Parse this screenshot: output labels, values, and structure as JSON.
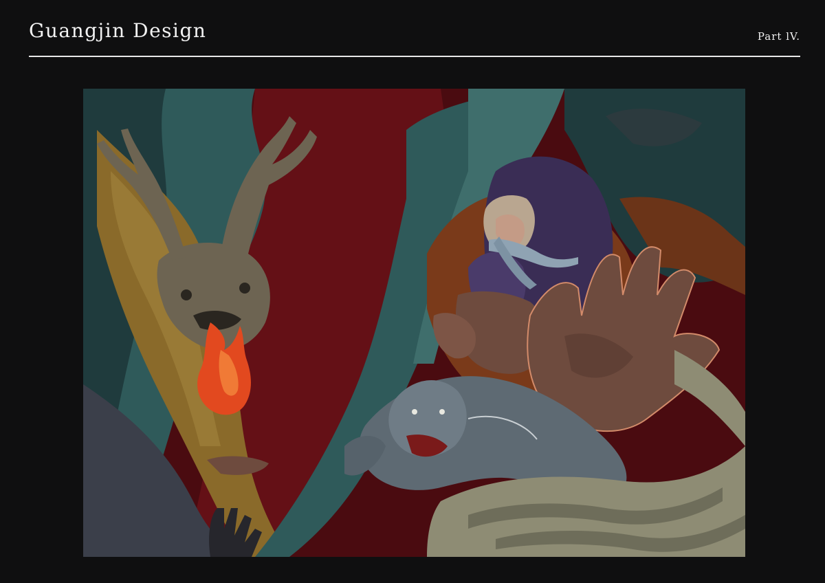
{
  "header": {
    "title": "Guangjin Design",
    "part": "Part lV."
  },
  "artwork": {
    "subject": "illustration-artwork",
    "palette": {
      "blood_red": "#4a0b10",
      "deep_red": "#6e1219",
      "teal": "#2f5a5a",
      "teal_dark": "#1f3b3d",
      "ochre": "#8a6a2a",
      "antler_brown": "#6d6452",
      "violet": "#3a2d55",
      "rust": "#7a3a1a",
      "skin": "#6e4b3e",
      "tiger_grey": "#5e6a73",
      "flame_orange": "#e2491f",
      "bone": "#8e8c74"
    }
  }
}
